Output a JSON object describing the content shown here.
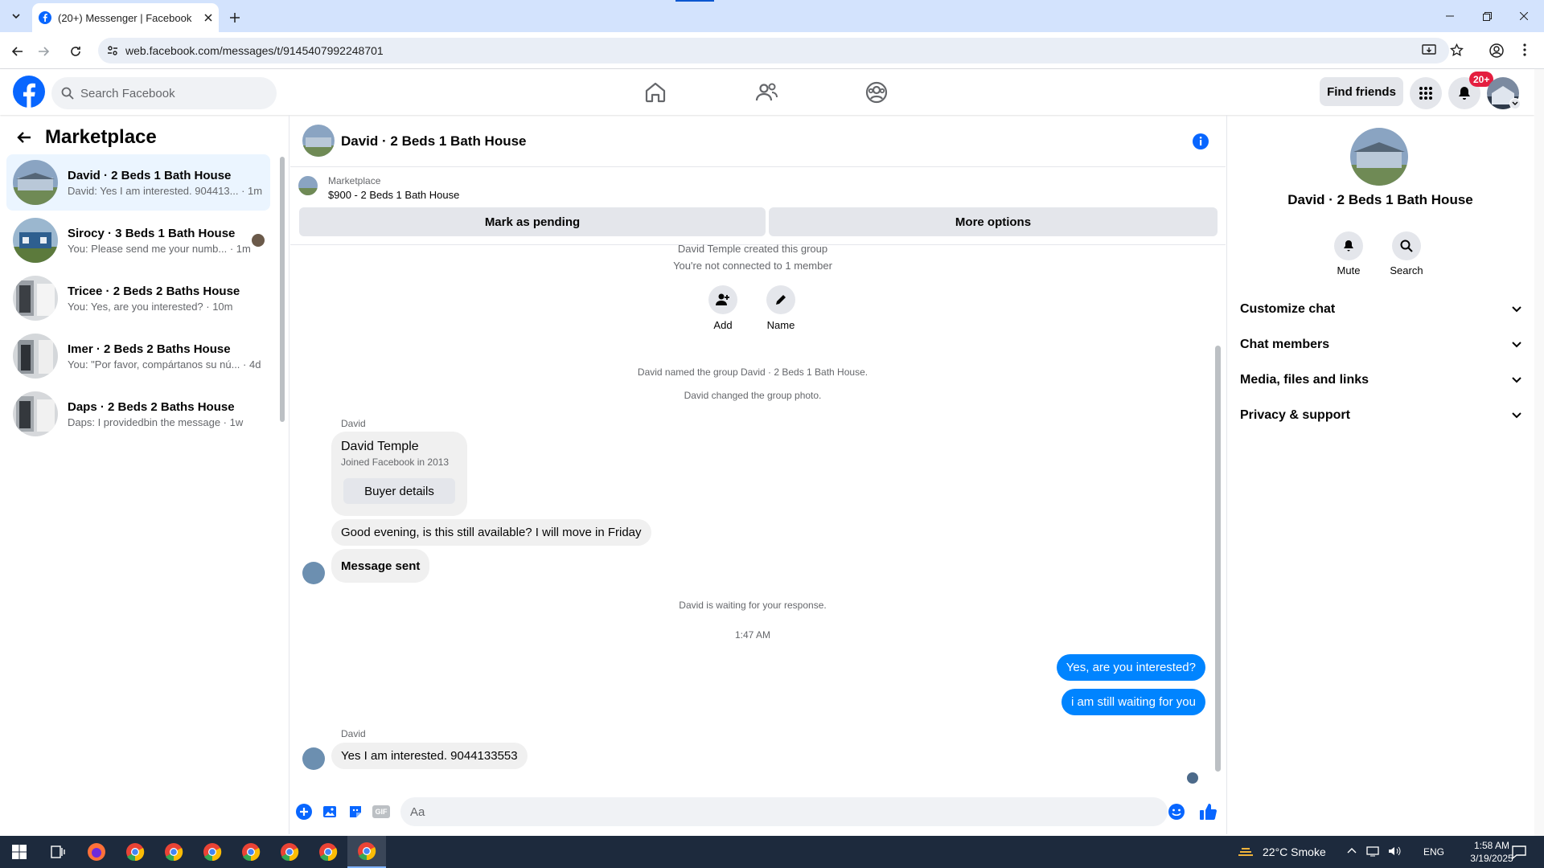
{
  "browser": {
    "tab_title": "(20+) Messenger | Facebook",
    "url": "web.facebook.com/messages/t/9145407992248701"
  },
  "header": {
    "search_placeholder": "Search Facebook",
    "find_friends": "Find friends",
    "notif_badge": "20+"
  },
  "sidebar": {
    "title": "Marketplace",
    "chats": [
      {
        "name": "David · 2 Beds 1 Bath House",
        "preview": "David: Yes I am interested. 904413... · 1m"
      },
      {
        "name": "Sirocy · 3 Beds 1 Bath House",
        "preview": "You: Please send me your numb... · 1m"
      },
      {
        "name": "Tricee · 2 Beds 2 Baths House",
        "preview": "You: Yes, are you interested? · 10m"
      },
      {
        "name": "Imer · 2 Beds 2 Baths House",
        "preview": "You: \"Por favor, compártanos su nú... · 4d"
      },
      {
        "name": "Daps · 2 Beds 2 Baths House",
        "preview": "Daps: I providedbin the message · 1w"
      }
    ]
  },
  "conversation": {
    "title": "David · 2 Beds 1 Bath House",
    "listing_label": "Marketplace",
    "listing_price": "$900 - 2 Beds 1 Bath House",
    "mark_pending": "Mark as pending",
    "more_options": "More options",
    "created_line": "David Temple created this group",
    "not_connected": "You're not connected to 1 member",
    "add_label": "Add",
    "name_label": "Name",
    "named_group": "David named the group David · 2 Beds 1 Bath House.",
    "changed_photo": "David changed the group photo.",
    "sender1": "David",
    "card_name": "David Temple",
    "card_joined": "Joined Facebook in 2013",
    "buyer_details": "Buyer details",
    "msg1": "Good evening, is this still available? I will move in Friday",
    "msg2": "Message sent",
    "waiting": "David is waiting for your response.",
    "time": "1:47 AM",
    "mine1": "Yes, are you interested?",
    "mine2": "i am still waiting for you",
    "sender2": "David",
    "msg3": "Yes I am interested. 9044133553",
    "composer_placeholder": "Aa"
  },
  "details": {
    "title": "David · 2 Beds 1 Bath House",
    "mute": "Mute",
    "search": "Search",
    "sections": [
      "Customize chat",
      "Chat members",
      "Media, files and links",
      "Privacy & support"
    ]
  },
  "taskbar": {
    "weather": "22°C  Smoke",
    "lang": "ENG",
    "time": "1:58 AM",
    "date": "3/19/2025"
  },
  "colors": {
    "accent": "#0866ff",
    "bubble_mine": "#0084ff",
    "badge": "#e41e3f"
  }
}
